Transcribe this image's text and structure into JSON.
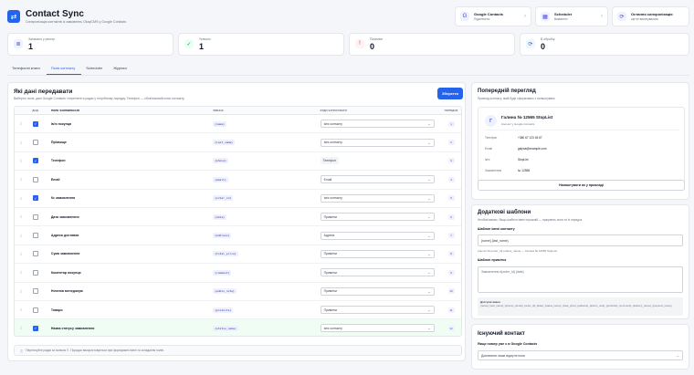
{
  "app": {
    "title": "Contact Sync",
    "subtitle": "Синхронізація контактів із замовлень OkayCMS у Google Contacts",
    "logo_icon": "sync-icon"
  },
  "top_cards": [
    {
      "title": "Google Contacts",
      "sub": "Підключено",
      "icon": "G"
    },
    {
      "title": "Scheduler",
      "sub": "Вимкнено",
      "icon": "▦"
    },
    {
      "title": "Остання синхронізація",
      "sub": "ще не виконувалась",
      "icon": "⟳"
    }
  ],
  "stats": [
    {
      "label": "Записано у реєстр",
      "value": "1",
      "icon": "≣",
      "bg": "#eef2ff",
      "fg": "#4f46e5"
    },
    {
      "label": "Успішно",
      "value": "1",
      "icon": "✓",
      "bg": "#ecfdf5",
      "fg": "#16a34a"
    },
    {
      "label": "Помилки",
      "value": "0",
      "icon": "!",
      "bg": "#fef2f2",
      "fg": "#dc2626"
    },
    {
      "label": "В обробці",
      "value": "0",
      "icon": "⟳",
      "bg": "#eff6ff",
      "fg": "#2563eb"
    }
  ],
  "tabs": [
    "Телефонні книги",
    "Поля контакту",
    "Scheduler",
    "Журнал"
  ],
  "active_tab": 1,
  "main": {
    "title": "Які дані передавати",
    "subtitle": "Виберіть поля, дані Google Contacts і перетягніть рядки у потрібному порядку. Телефон — обов'язковий ключ контакту.",
    "save_label": "Зберегти",
    "columns": [
      "ДОД.",
      "ПОЛЕ ЗАМОВЛЕННЯ",
      "ЗМІННА",
      "КУДИ ЗАПИСУВАТИ",
      "ПОРЯДОК"
    ],
    "rows": [
      {
        "checked": true,
        "name": "Ім'я покупця",
        "var": "{name}",
        "where": "Ім'я контакту",
        "type": "select",
        "order": "1"
      },
      {
        "checked": false,
        "name": "Прізвище",
        "var": "{last_name}",
        "where": "Ім'я контакту",
        "type": "select",
        "order": "2"
      },
      {
        "checked": true,
        "name": "Телефон",
        "var": "{phone}",
        "where": "Телефон",
        "type": "chip",
        "order": "3"
      },
      {
        "checked": false,
        "name": "Email",
        "var": "{email}",
        "where": "Email",
        "type": "select",
        "order": "4"
      },
      {
        "checked": true,
        "name": "№ замовлення",
        "var": "{order_id}",
        "where": "Ім'я контакту",
        "type": "select",
        "order": "5"
      },
      {
        "checked": false,
        "name": "Дата замовлення",
        "var": "{date}",
        "where": "Примітки",
        "type": "select",
        "order": "6"
      },
      {
        "checked": false,
        "name": "Адреса доставки",
        "var": "{address}",
        "where": "Адреса",
        "type": "select",
        "order": "7"
      },
      {
        "checked": false,
        "name": "Сума замовлення",
        "var": "{total_price}",
        "where": "Примітки",
        "type": "select",
        "order": "8"
      },
      {
        "checked": false,
        "name": "Коментар покупця",
        "var": "{comment}",
        "where": "Примітки",
        "type": "select",
        "order": "9"
      },
      {
        "checked": false,
        "name": "Нотатка менеджера",
        "var": "{admin_note}",
        "where": "Примітки",
        "type": "select",
        "order": "10"
      },
      {
        "checked": false,
        "name": "Товари",
        "var": "{products}",
        "where": "Примітки",
        "type": "select",
        "order": "11"
      },
      {
        "checked": true,
        "name": "Назва статусу замовлення",
        "var": "{status_name}",
        "where": "Ім'я контакту",
        "type": "select",
        "order": "12"
      }
    ],
    "footer_note": "Перетягуйте рядки за іконкою ⠿. Порядок використовується при формуванні імені та складання полів."
  },
  "preview": {
    "title": "Попередній перегляд",
    "subtitle": "Приклад контакту, який буде сформовано з налаштувань",
    "avatar": "Г",
    "name": "Галина № 12565 StopList",
    "sub": "Контакт у Google Contacts",
    "fields": [
      {
        "k": "Телефон",
        "v": "+380 67 123 45 67"
      },
      {
        "k": "Email",
        "v": "galyna@example.com"
      },
      {
        "k": "Ім'я",
        "v": "StopList"
      },
      {
        "k": "Замовлення",
        "v": "№ 12565"
      }
    ],
    "button": "Налаштувати як у прикладі"
  },
  "templates": {
    "title": "Додаткові шаблони",
    "subtitle": "Необов'язково. Якщо шаблон імені порожній — працюють поля та їх порядок.",
    "name_label": "Шаблон імені контакту",
    "name_value": "{name} {last_name}",
    "name_hint": "{name} № {order_id} {status_name} — Галина № 12565 StopList",
    "note_label": "Шаблон приміток",
    "note_placeholder": "Замовлення #{order_id} {date}",
    "vars_title": "Доступні змінні",
    "vars": "{name}, {last_name}, {phone}, {email}, {order_id}, {date}, {status_name}, {total_price}, {address}, {admin_note}, {products}, {comment}, {delivery_name}, {payment_name}"
  },
  "existing": {
    "title": "Існуючий контакт",
    "label": "Якщо номер уже є в Google Contacts",
    "value": "Доповнити лише відсутні поля"
  }
}
